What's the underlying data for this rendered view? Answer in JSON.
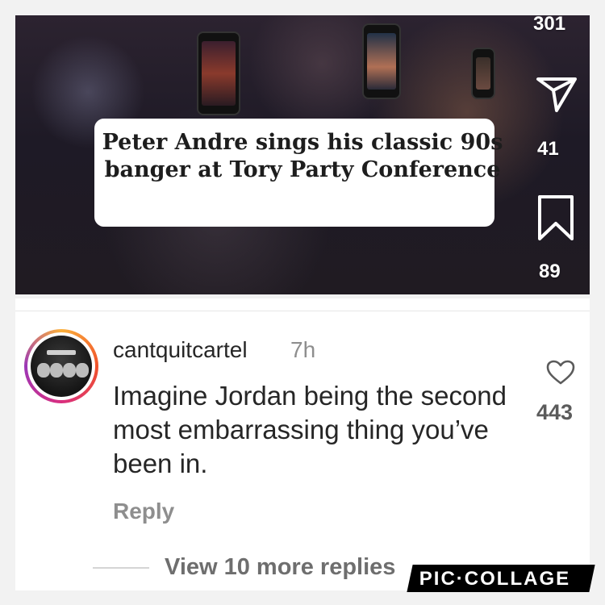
{
  "post": {
    "caption": "Peter Andre sings his classic 90s banger at Tory Party Conference",
    "views": "301",
    "shares": "41",
    "saves": "89"
  },
  "comment": {
    "username": "cantquitcartel",
    "time": "7h",
    "text": "Imagine Jordan being the second most embarrassing thing you’ve been in.",
    "like_count": "443",
    "reply_label": "Reply",
    "view_replies_label": "View 10 more replies"
  },
  "watermark": "PIC·COLLAGE",
  "icons": {
    "share": "paper-plane-icon",
    "save": "bookmark-icon",
    "like": "heart-icon"
  },
  "colors": {
    "username": "#262626",
    "muted": "#8e8e8e",
    "story_ring": [
      "#fbb03b",
      "#f0512a",
      "#d92e7f",
      "#9b36b7"
    ]
  }
}
